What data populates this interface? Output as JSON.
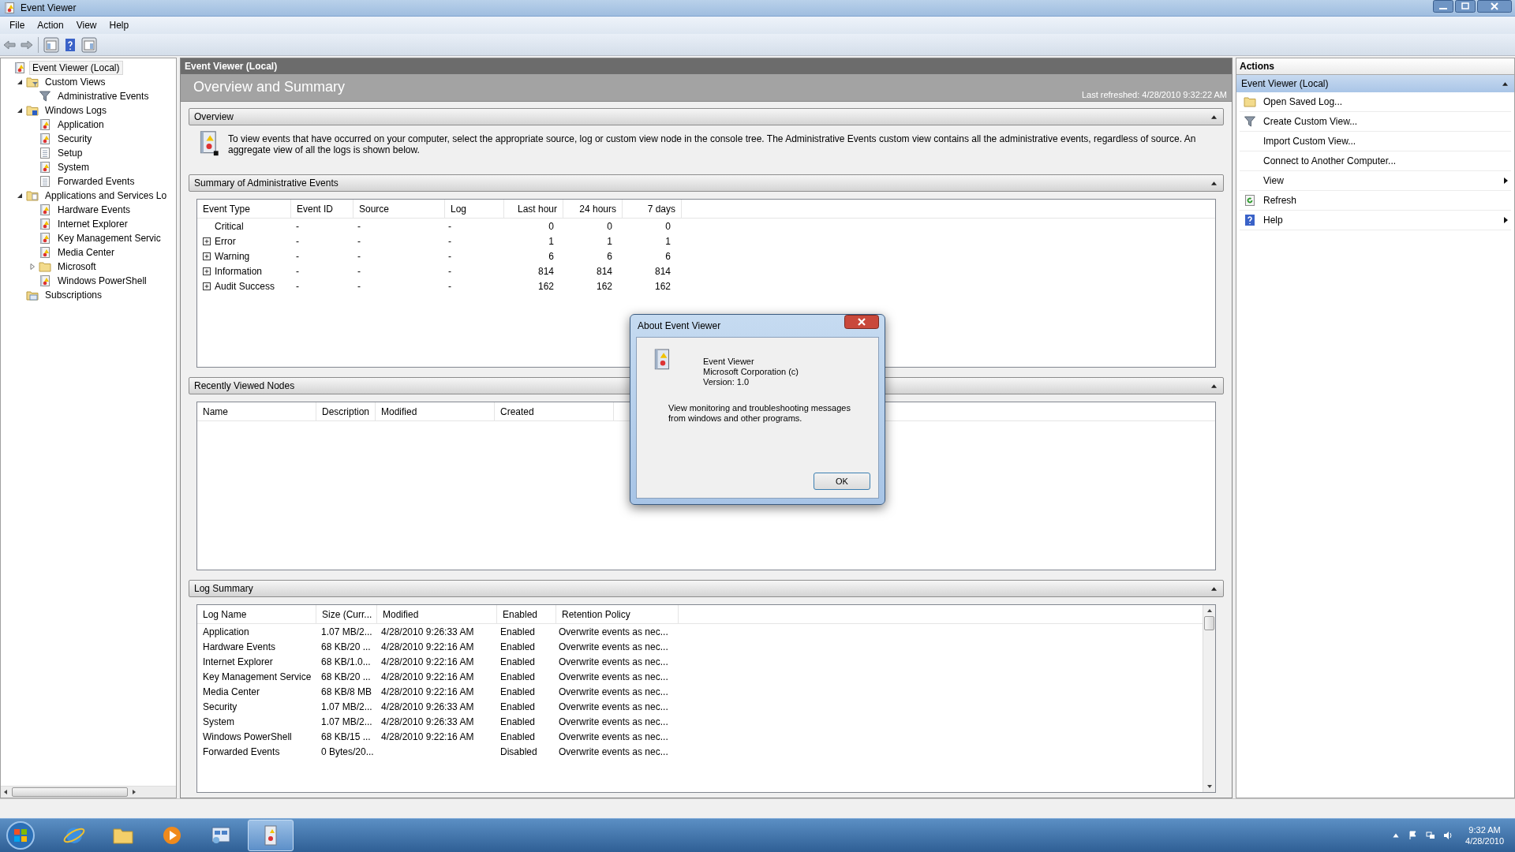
{
  "window": {
    "title": "Event Viewer"
  },
  "menu": [
    "File",
    "Action",
    "View",
    "Help"
  ],
  "tree": [
    {
      "label": "Event Viewer (Local)",
      "kind": "viewer",
      "selected": true,
      "children": [
        {
          "label": "Custom Views",
          "kind": "folder-filter",
          "expanded": true,
          "selected": false,
          "children": [
            {
              "label": "Administrative Events",
              "kind": "filter",
              "selected": false
            }
          ]
        },
        {
          "label": "Windows Logs",
          "kind": "folder-logs",
          "expanded": true,
          "selected": false,
          "children": [
            {
              "label": "Application",
              "kind": "log",
              "selected": false
            },
            {
              "label": "Security",
              "kind": "log",
              "selected": false
            },
            {
              "label": "Setup",
              "kind": "page",
              "selected": false
            },
            {
              "label": "System",
              "kind": "log",
              "selected": false
            },
            {
              "label": "Forwarded Events",
              "kind": "page",
              "selected": false
            }
          ]
        },
        {
          "label": "Applications and Services Lo",
          "kind": "folder-apps",
          "expanded": true,
          "selected": false,
          "children": [
            {
              "label": "Hardware Events",
              "kind": "log",
              "selected": false
            },
            {
              "label": "Internet Explorer",
              "kind": "log",
              "selected": false
            },
            {
              "label": "Key Management Servic",
              "kind": "log",
              "selected": false
            },
            {
              "label": "Media Center",
              "kind": "log",
              "selected": false
            },
            {
              "label": "Microsoft",
              "kind": "folder",
              "expanded": false,
              "selected": false
            },
            {
              "label": "Windows PowerShell",
              "kind": "log",
              "selected": false
            }
          ]
        },
        {
          "label": "Subscriptions",
          "kind": "subscriptions",
          "selected": false
        }
      ]
    }
  ],
  "center": {
    "header": "Event Viewer (Local)",
    "title": "Overview and Summary",
    "refreshed": "Last refreshed: 4/28/2010 9:32:22 AM",
    "sections": [
      {
        "kind": "overview",
        "title": "Overview",
        "expanded": true,
        "text": "To view events that have occurred on your computer, select the appropriate source, log or custom view node in the console tree. The Administrative Events custom view contains all the administrative events, regardless of source. An aggregate view of all the logs is shown below."
      },
      {
        "kind": "events",
        "title": "Summary of Administrative Events",
        "expanded": true,
        "columns": [
          "Event Type",
          "Event ID",
          "Source",
          "Log",
          "Last hour",
          "24 hours",
          "7 days"
        ],
        "rows": [
          {
            "expandable": false,
            "cells": [
              "Critical",
              "-",
              "-",
              "-",
              "0",
              "0",
              "0"
            ]
          },
          {
            "expandable": true,
            "cells": [
              "Error",
              "-",
              "-",
              "-",
              "1",
              "1",
              "1"
            ]
          },
          {
            "expandable": true,
            "cells": [
              "Warning",
              "-",
              "-",
              "-",
              "6",
              "6",
              "6"
            ]
          },
          {
            "expandable": true,
            "cells": [
              "Information",
              "-",
              "-",
              "-",
              "814",
              "814",
              "814"
            ]
          },
          {
            "expandable": true,
            "cells": [
              "Audit Success",
              "-",
              "-",
              "-",
              "162",
              "162",
              "162"
            ]
          }
        ]
      },
      {
        "kind": "nodes",
        "title": "Recently Viewed Nodes",
        "expanded": true,
        "columns": [
          "Name",
          "Description",
          "Modified",
          "Created"
        ]
      },
      {
        "kind": "logs",
        "title": "Log Summary",
        "expanded": true,
        "columns": [
          "Log Name",
          "Size (Curr...",
          "Modified",
          "Enabled",
          "Retention Policy"
        ],
        "rows": [
          {
            "cells": [
              "Application",
              "1.07 MB/2...",
              "4/28/2010 9:26:33 AM",
              "Enabled",
              "Overwrite events as nec..."
            ]
          },
          {
            "cells": [
              "Hardware Events",
              "68 KB/20 ...",
              "4/28/2010 9:22:16 AM",
              "Enabled",
              "Overwrite events as nec..."
            ]
          },
          {
            "cells": [
              "Internet Explorer",
              "68 KB/1.0...",
              "4/28/2010 9:22:16 AM",
              "Enabled",
              "Overwrite events as nec..."
            ]
          },
          {
            "cells": [
              "Key Management Service",
              "68 KB/20 ...",
              "4/28/2010 9:22:16 AM",
              "Enabled",
              "Overwrite events as nec..."
            ]
          },
          {
            "cells": [
              "Media Center",
              "68 KB/8 MB",
              "4/28/2010 9:22:16 AM",
              "Enabled",
              "Overwrite events as nec..."
            ]
          },
          {
            "cells": [
              "Security",
              "1.07 MB/2...",
              "4/28/2010 9:26:33 AM",
              "Enabled",
              "Overwrite events as nec..."
            ]
          },
          {
            "cells": [
              "System",
              "1.07 MB/2...",
              "4/28/2010 9:26:33 AM",
              "Enabled",
              "Overwrite events as nec..."
            ]
          },
          {
            "cells": [
              "Windows PowerShell",
              "68 KB/15 ...",
              "4/28/2010 9:22:16 AM",
              "Enabled",
              "Overwrite events as nec..."
            ]
          },
          {
            "cells": [
              "Forwarded Events",
              "0 Bytes/20...",
              "",
              "Disabled",
              "Overwrite events as nec..."
            ]
          }
        ]
      }
    ]
  },
  "actions": {
    "title": "Actions",
    "group": {
      "label": "Event Viewer (Local)",
      "expanded": true
    },
    "items": [
      {
        "label": "Open Saved Log...",
        "kind": "folder",
        "submenu": false
      },
      {
        "label": "Create Custom View...",
        "kind": "filter",
        "submenu": false
      },
      {
        "label": "Import Custom View...",
        "kind": "none",
        "submenu": false
      },
      {
        "label": "Connect to Another Computer...",
        "kind": "none",
        "submenu": false
      },
      {
        "label": "View",
        "kind": "none",
        "submenu": true
      },
      {
        "label": "Refresh",
        "kind": "refresh",
        "submenu": false
      },
      {
        "label": "Help",
        "kind": "help",
        "submenu": true
      }
    ]
  },
  "dialog": {
    "title": "About Event Viewer",
    "lines": [
      "Event Viewer",
      "Microsoft Corporation (c)",
      "Version: 1.0"
    ],
    "description": "View monitoring and troubleshooting messages from windows and other programs.",
    "button": "OK"
  },
  "taskbar": {
    "apps": [
      {
        "kind": "browser",
        "active": false
      },
      {
        "kind": "files",
        "active": false
      },
      {
        "kind": "media",
        "active": false
      },
      {
        "kind": "console",
        "active": false
      },
      {
        "kind": "viewer",
        "active": true
      }
    ],
    "time": "9:32 AM",
    "date": "4/28/2010"
  }
}
